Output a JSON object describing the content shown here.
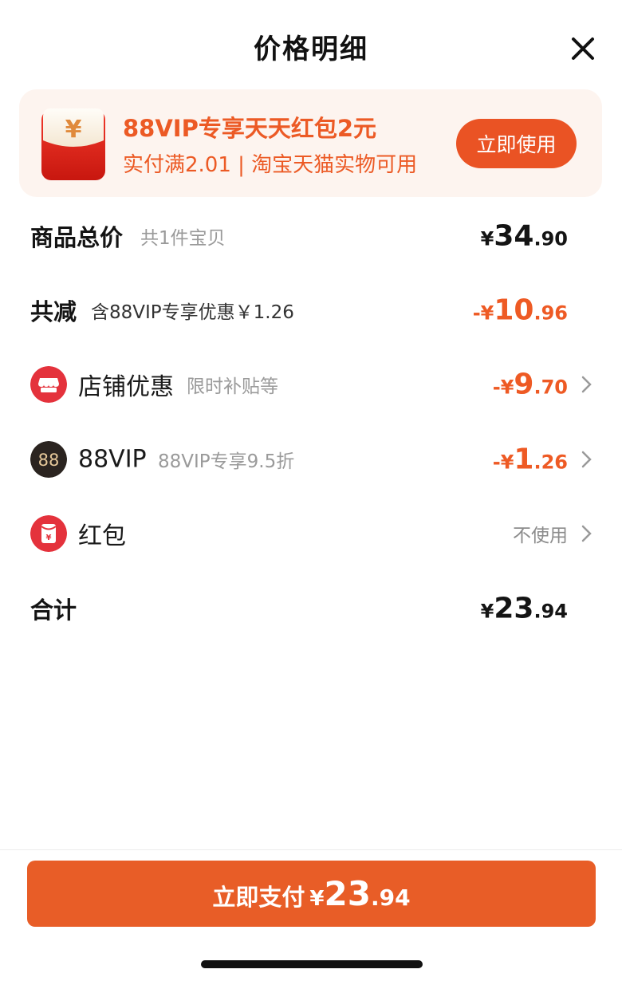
{
  "title": "价格明细",
  "banner": {
    "title": "88VIP专享天天红包2元",
    "subtitle": "实付满2.01 | 淘宝天猫实物可用",
    "button": "立即使用",
    "icon_glyph": "¥"
  },
  "rows": {
    "total": {
      "label": "商品总价",
      "sub": "共1件宝贝",
      "currency": "¥",
      "int": "34",
      "dec": ".90"
    },
    "reduce": {
      "label": "共减",
      "sub": "含88VIP专享优惠￥1.26",
      "currency": "-¥",
      "int": "10",
      "dec": ".96"
    },
    "shop": {
      "label": "店铺优惠",
      "sub": "限时补贴等",
      "currency": "-¥",
      "int": "9",
      "dec": ".70"
    },
    "vip": {
      "label": "88VIP",
      "sub": "88VIP专享9.5折",
      "badge": "88",
      "currency": "-¥",
      "int": "1",
      "dec": ".26"
    },
    "redpack": {
      "label": "红包",
      "value": "不使用",
      "icon_glyph": "¥"
    },
    "sum": {
      "label": "合计",
      "currency": "¥",
      "int": "23",
      "dec": ".94"
    }
  },
  "pay": {
    "label": "立即支付",
    "currency": "¥",
    "int": "23",
    "dec": ".94"
  },
  "colors": {
    "accent": "#ea5324",
    "banner_bg": "#fdf4ef",
    "text": "#141414",
    "muted": "#9a9a9a"
  }
}
